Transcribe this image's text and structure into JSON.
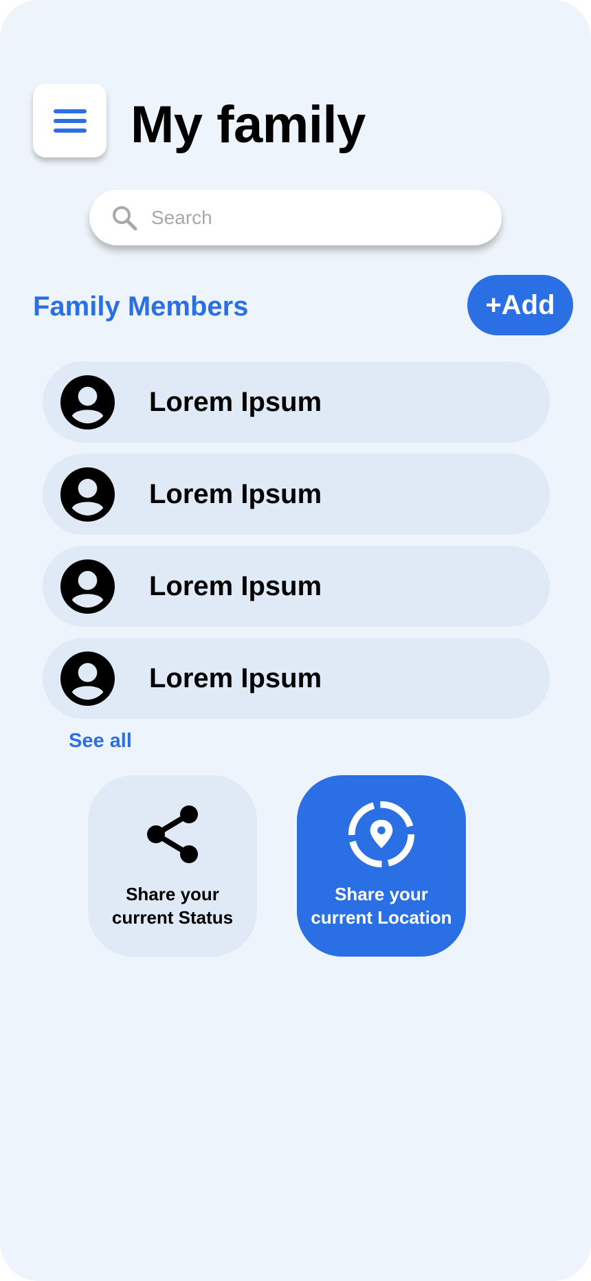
{
  "header": {
    "title": "My family",
    "menu_icon": "hamburger-menu-icon"
  },
  "search": {
    "placeholder": "Search",
    "value": "",
    "icon": "search-icon"
  },
  "members": {
    "section_title": "Family Members",
    "add_label": "+Add",
    "items": [
      {
        "name": "Lorem Ipsum",
        "icon": "user-avatar-icon"
      },
      {
        "name": "Lorem Ipsum",
        "icon": "user-avatar-icon"
      },
      {
        "name": "Lorem Ipsum",
        "icon": "user-avatar-icon"
      },
      {
        "name": "Lorem Ipsum",
        "icon": "user-avatar-icon"
      }
    ],
    "see_all_label": "See all"
  },
  "actions": {
    "share_status": {
      "line1": "Share your",
      "line2": "current Status",
      "icon": "share-icon"
    },
    "share_location": {
      "line1": "Share your",
      "line2": "current Location",
      "icon": "location-pin-icon"
    }
  },
  "colors": {
    "accent": "#2a6fe3",
    "background": "#eef4fb",
    "row_background": "#dfeaf6",
    "text": "#000000",
    "placeholder": "#a8a8a8"
  }
}
